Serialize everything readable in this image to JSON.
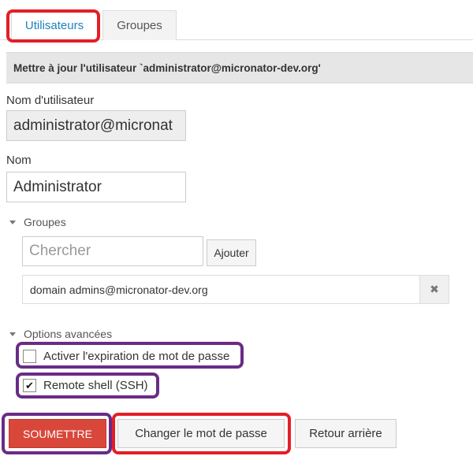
{
  "tabs": {
    "users": "Utilisateurs",
    "groups": "Groupes"
  },
  "header": {
    "title": "Mettre à jour l'utilisateur `administrator@micronator-dev.org'"
  },
  "form": {
    "username": {
      "label": "Nom d'utilisateur",
      "value": "administrator@micronat"
    },
    "name": {
      "label": "Nom",
      "value": "Administrator"
    },
    "groups": {
      "toggle": "Groupes",
      "search_placeholder": "Chercher",
      "add_label": "Ajouter",
      "items": [
        "domain admins@micronator-dev.org"
      ],
      "remove_glyph": "✖"
    },
    "advanced": {
      "toggle": "Options avancées",
      "password_expiry": {
        "label": "Activer l'expiration de mot de passe",
        "checked": false
      },
      "remote_shell": {
        "label": "Remote shell (SSH)",
        "checked": true,
        "check_glyph": "✔"
      }
    }
  },
  "actions": {
    "submit": "SOUMETTRE",
    "change_password": "Changer le mot de passe",
    "back": "Retour arrière"
  },
  "annotations": {
    "red": "#e41e26",
    "purple": "#6a2b86"
  }
}
